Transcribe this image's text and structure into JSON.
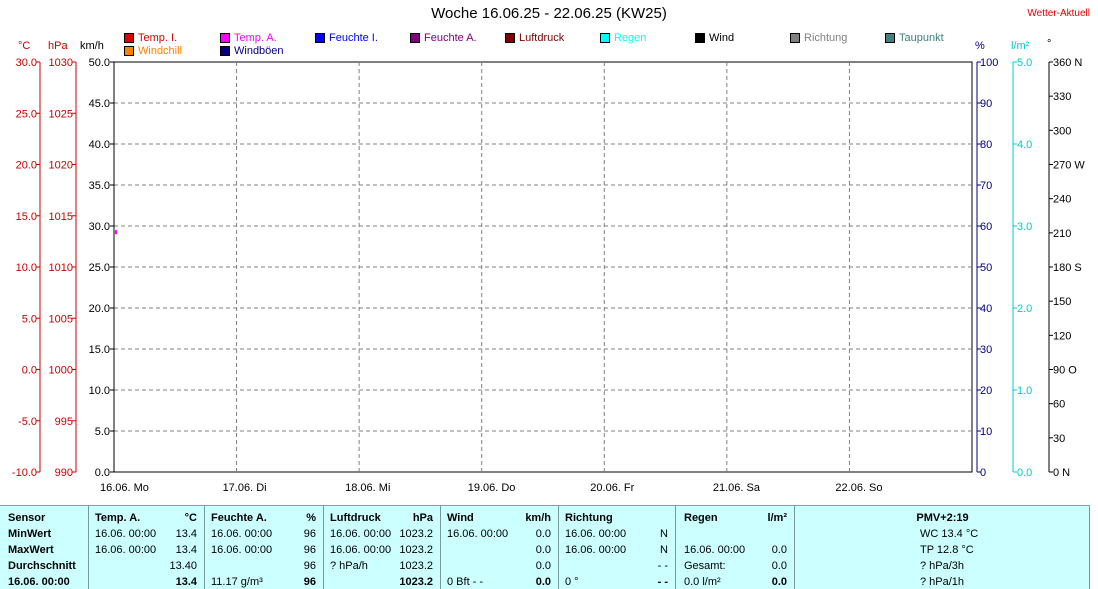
{
  "title": "Woche 16.06.25 - 22.06.25 (KW25)",
  "brand": "Wetter-Aktuell",
  "units": {
    "temp": "°C",
    "pressure": "hPa",
    "wind": "km/h",
    "humidity": "%",
    "rain": "l/m²",
    "direction": "°"
  },
  "legend": [
    {
      "label": "Temp. I.",
      "color": "#e00000"
    },
    {
      "label": "Temp. A.",
      "color": "#ff00ff"
    },
    {
      "label": "Feuchte I.",
      "color": "#0000ff"
    },
    {
      "label": "Feuchte A.",
      "color": "#800080"
    },
    {
      "label": "Luftdruck",
      "color": "#800000"
    },
    {
      "label": "Regen",
      "color": "#00ffff"
    },
    {
      "label": "Wind",
      "color": "#000000"
    },
    {
      "label": "Richtung",
      "color": "#808080"
    },
    {
      "label": "Taupunkt",
      "color": "#408080"
    },
    {
      "label": "Windchill",
      "color": "#ff8000"
    },
    {
      "label": "Windböen",
      "color": "#000080"
    }
  ],
  "colors": {
    "temp": "#cc0000",
    "pressure": "#cc0000",
    "wind": "#000000",
    "humidity": "#000080",
    "rain": "#00cccc",
    "direction": "#000000",
    "grid": "#808080"
  },
  "chart_data": {
    "type": "line",
    "x_categories": [
      "16.06.  Mo",
      "17.06.  Di",
      "18.06.  Mi",
      "19.06.  Do",
      "20.06.  Fr",
      "21.06.  Sa",
      "22.06.  So"
    ],
    "axes": {
      "temp": {
        "min": -10,
        "max": 30,
        "ticks": [
          "30.0",
          "25.0",
          "20.0",
          "15.0",
          "10.0",
          "5.0",
          "0.0",
          "-5.0",
          "-10.0"
        ]
      },
      "pressure": {
        "min": 990,
        "max": 1030,
        "ticks": [
          "1030",
          "1025",
          "1020",
          "1015",
          "1010",
          "1005",
          "1000",
          "995",
          "990"
        ]
      },
      "wind": {
        "min": 0,
        "max": 50,
        "ticks": [
          "50.0",
          "45.0",
          "40.0",
          "35.0",
          "30.0",
          "25.0",
          "20.0",
          "15.0",
          "10.0",
          "5.0",
          "0.0"
        ]
      },
      "humidity": {
        "min": 0,
        "max": 100,
        "ticks": [
          "100",
          "90",
          "80",
          "70",
          "60",
          "50",
          "40",
          "30",
          "20",
          "10",
          "0"
        ]
      },
      "rain": {
        "min": 0,
        "max": 5,
        "ticks": [
          "5.0",
          "4.0",
          "3.0",
          "2.0",
          "1.0",
          "0.0"
        ]
      },
      "direction": {
        "min": 0,
        "max": 360,
        "ticks": [
          "360 N",
          "330",
          "300",
          "270 W",
          "240",
          "210",
          "180 S",
          "150",
          "120",
          "90  O",
          "60",
          "30",
          "0    N"
        ]
      }
    },
    "series": [
      {
        "name": "Temp. A.",
        "color": "#ff00ff",
        "axis": "temp",
        "x": [
          0
        ],
        "values": [
          13.4
        ]
      }
    ],
    "grid": true
  },
  "table": {
    "row_labels": [
      "Sensor",
      "MinWert",
      "MaxWert",
      "Durchschnitt",
      "16.06.  00:00"
    ],
    "temp": {
      "header": "Temp. A.",
      "unit": "°C",
      "rows": [
        [
          "16.06.  00:00",
          "13.4"
        ],
        [
          "16.06.  00:00",
          "13.4"
        ],
        [
          "",
          "13.40"
        ],
        [
          "",
          "13.4"
        ]
      ]
    },
    "humidity": {
      "header": "Feuchte A.",
      "unit": "%",
      "rows": [
        [
          "16.06.  00:00",
          "96"
        ],
        [
          "16.06.  00:00",
          "96"
        ],
        [
          "",
          "96"
        ],
        [
          "11.17 g/m³",
          "96"
        ]
      ]
    },
    "pressure": {
      "header": "Luftdruck",
      "unit": "hPa",
      "rows": [
        [
          "16.06.  00:00",
          "1023.2"
        ],
        [
          "16.06.  00:00",
          "1023.2"
        ],
        [
          "? hPa/h",
          "1023.2"
        ],
        [
          "",
          "1023.2"
        ]
      ]
    },
    "wind": {
      "header": "Wind",
      "unit": "km/h",
      "rows": [
        [
          "16.06.  00:00",
          "0.0"
        ],
        [
          "",
          "0.0"
        ],
        [
          "",
          "0.0"
        ],
        [
          "0 Bft - -",
          "0.0"
        ]
      ]
    },
    "direction": {
      "header": "Richtung",
      "unit": "",
      "rows": [
        [
          "16.06.  00:00",
          "N"
        ],
        [
          "16.06.  00:00",
          "N"
        ],
        [
          "",
          "- -"
        ],
        [
          "0 °",
          "- -"
        ]
      ]
    },
    "rain": {
      "header": "Regen",
      "unit": "l/m²",
      "rows": [
        [
          "",
          ""
        ],
        [
          "16.06.  00:00",
          "0.0"
        ],
        [
          "Gesamt:",
          "0.0"
        ],
        [
          "0.0 l/m²",
          "0.0"
        ]
      ]
    },
    "pmv": {
      "header": "PMV+2:19",
      "rows": [
        "WC 13.4 °C",
        "TP 12.8 °C",
        "? hPa/3h",
        "? hPa/1h"
      ]
    }
  }
}
